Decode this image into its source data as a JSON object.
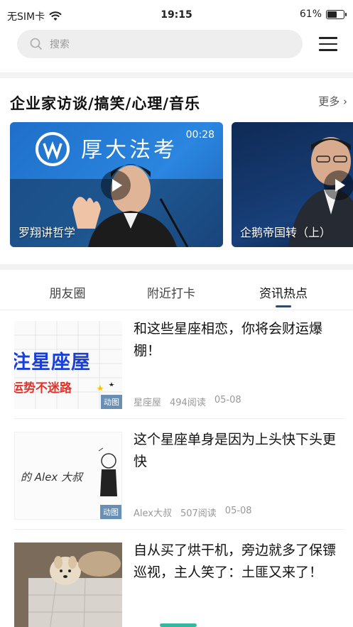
{
  "status_bar": {
    "carrier": "无SIM卡",
    "time": "19:15",
    "battery_percent": "61%",
    "battery_level": 0.61
  },
  "search": {
    "placeholder": "搜索"
  },
  "featured_section": {
    "title": "企业家访谈/搞笑/心理/音乐",
    "more_label": "更多",
    "videos": [
      {
        "title": "罗翔讲哲学",
        "duration": "00:28",
        "overlay_text": "厚大法考"
      },
      {
        "title": "企鹅帝国转（上）",
        "duration": ""
      }
    ]
  },
  "tabs": [
    {
      "label": "朋友圈",
      "active": false
    },
    {
      "label": "附近打卡",
      "active": false
    },
    {
      "label": "资讯热点",
      "active": true
    }
  ],
  "news": [
    {
      "title": "和这些星座相恋，你将会财运爆棚！",
      "source": "星座屋",
      "reads": "494阅读",
      "date": "05-08",
      "tag": "动图",
      "thumb_line1": "注星座屋",
      "thumb_line2": "运势不迷路"
    },
    {
      "title": "这个星座单身是因为上头快下头更快",
      "source": "Alex大叔",
      "reads": "507阅读",
      "date": "05-08",
      "tag": "动图",
      "thumb_line1": "的 Alex 大叔"
    },
    {
      "title": "自从买了烘干机，旁边就多了保镖巡视，主人笑了：土匪又来了！",
      "source": "",
      "reads": "",
      "date": "",
      "tag": ""
    }
  ],
  "colors": {
    "accent": "#2d4a6e",
    "tag_bg": "#6a8fb5",
    "bottom_indicator": "#34b8a0"
  }
}
